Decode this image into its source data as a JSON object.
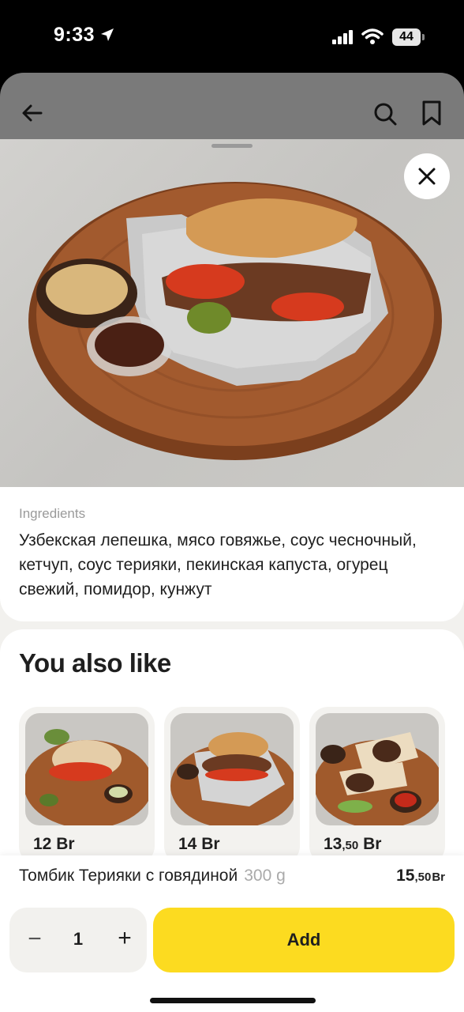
{
  "status_bar": {
    "time": "9:33",
    "battery": "44"
  },
  "product": {
    "ingredients_label": "Ingredients",
    "ingredients_text": "Узбекская лепешка, мясо говяжье, соус чесночный, кетчуп, соус терияки, пекинская капуста, огурец свежий, помидор, кунжут",
    "name": "Томбик Терияки с говядиной",
    "weight": "300 g",
    "price_main": "15",
    "price_cents": ",50",
    "price_currency": "Br"
  },
  "recommendations": {
    "title": "You also like",
    "items": [
      {
        "price_main": "12",
        "price_cents": "",
        "currency": "Br"
      },
      {
        "price_main": "14",
        "price_cents": "",
        "currency": "Br"
      },
      {
        "price_main": "13",
        "price_cents": ",50",
        "currency": "Br"
      }
    ]
  },
  "cart": {
    "quantity": "1",
    "minus_label": "−",
    "plus_label": "+",
    "add_label": "Add"
  },
  "icons": [
    "location-arrow-icon",
    "signal-icon",
    "wifi-icon",
    "back-arrow-icon",
    "search-icon",
    "bookmark-icon",
    "close-icon"
  ],
  "colors": {
    "accent": "#fcdb20",
    "muted_text": "#9a9a9a"
  }
}
